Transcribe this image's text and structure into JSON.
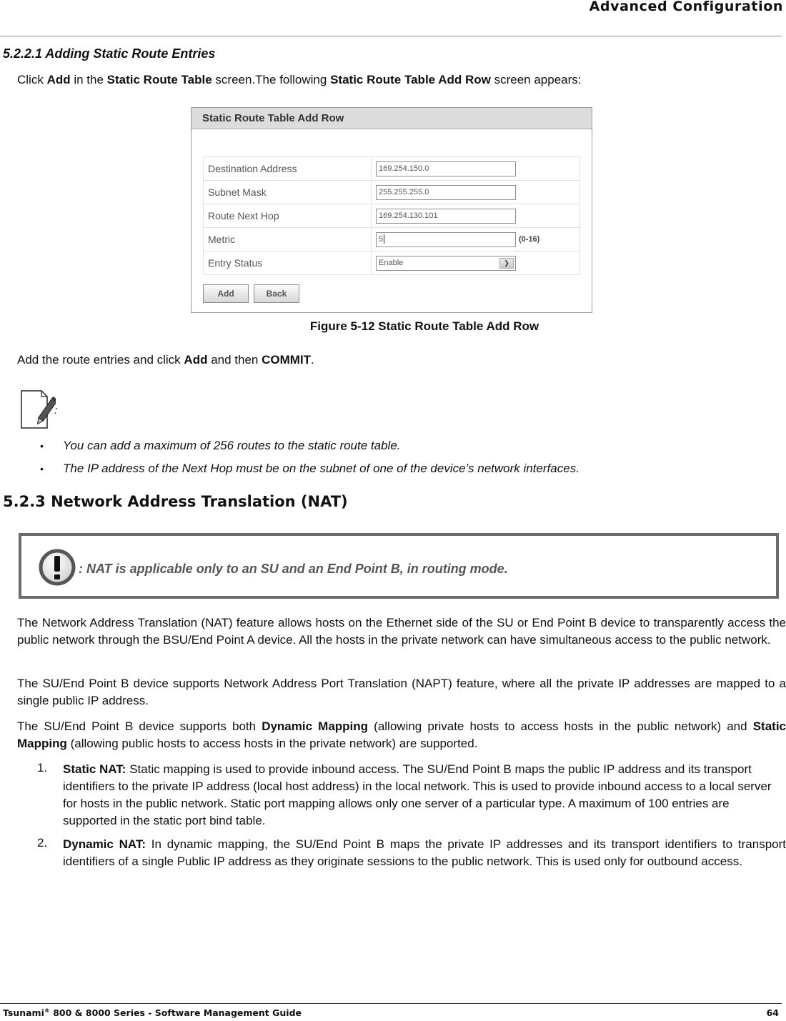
{
  "header": {
    "chapter_title": "Advanced Configuration"
  },
  "section_5221": {
    "heading": "5.2.2.1 Adding Static Route Entries",
    "intro": {
      "t1": "Click ",
      "b1": "Add",
      "t2": " in the ",
      "b2": "Static Route Table",
      "t3": " screen.The following ",
      "b3": "Static Route Table Add Row",
      "t4": " screen appears:"
    },
    "figure": {
      "title": "Static Route Table Add Row",
      "rows": [
        {
          "label": "Destination Address",
          "value": "169.254.150.0"
        },
        {
          "label": "Subnet Mask",
          "value": "255.255.255.0"
        },
        {
          "label": "Route Next Hop",
          "value": "169.254.130.101"
        },
        {
          "label": "Metric",
          "value": "5",
          "hint": "(0-16)"
        },
        {
          "label": "Entry Status",
          "value": "Enable"
        }
      ],
      "add_button": "Add",
      "back_button": "Back",
      "caption": "Figure 5-12 Static Route Table Add Row"
    },
    "after": {
      "t1": "Add the route entries and click ",
      "b1": "Add",
      "t2": " and then ",
      "b2": "COMMIT",
      "t3": "."
    },
    "note": {
      "icon": "note-pencil-icon",
      "colon": ":",
      "bullets": [
        "You can add a maximum of 256 routes to the static route table.",
        "The IP address of the Next Hop must be on the subnet of one of the device’s network interfaces."
      ]
    }
  },
  "section_523": {
    "heading": "5.2.3 Network Address Translation (NAT)",
    "warning": {
      "icon": "exclamation-icon",
      "text": ": NAT is applicable only to an SU and an End Point B, in routing mode."
    },
    "p1": "The Network Address Translation (NAT) feature allows hosts on the Ethernet side of the SU or End Point B device to transparently access the public network through the BSU/End Point A device. All the hosts in the private network can have simultaneous access to the public network.",
    "p2": "The SU/End Point B device supports Network Address Port Translation (NAPT) feature, where all the private IP addresses are mapped to a single public IP address.",
    "p3": {
      "t1": "The SU/End Point B device supports both ",
      "b1": "Dynamic Mapping",
      "t2": " (allowing private hosts to access hosts in the public network) and ",
      "b2": "Static Mapping",
      "t3": " (allowing public hosts to access hosts in the private network) are supported."
    },
    "list": [
      {
        "num": "1.",
        "term": "Static NAT:",
        "text": " Static mapping is used to provide inbound access. The SU/End Point B maps the public IP address and its transport identifiers to the private IP address (local host address) in the local network. This is used to provide inbound access to a local server for hosts in the public network. Static port mapping allows only one server of a particular type. A maximum of 100 entries are supported in the static port bind table."
      },
      {
        "num": "2.",
        "term": "Dynamic NAT:",
        "text": " In dynamic mapping, the SU/End Point B maps the private IP addresses and its transport identifiers to transport identifiers of a single Public IP address as they originate sessions to the public network. This is used only for outbound access."
      }
    ]
  },
  "footer": {
    "product": "Tsunami",
    "reg": "®",
    "rest": " 800 & 8000 Series - Software Management Guide",
    "page_number": "64"
  }
}
